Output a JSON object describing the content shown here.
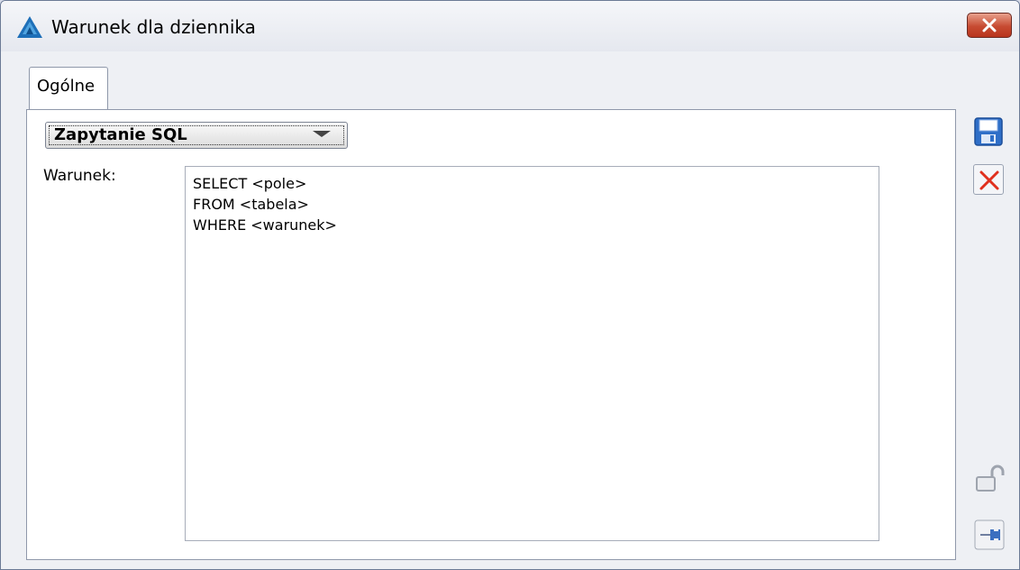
{
  "window": {
    "title": "Warunek dla dziennika",
    "accent": "#1a7bc4",
    "close_color": "#c74b32"
  },
  "tabs": [
    {
      "label": "Ogólne",
      "active": true
    }
  ],
  "form": {
    "mode_select": {
      "selected": "Zapytanie SQL"
    },
    "condition_label": "Warunek:",
    "condition_value": "SELECT <pole>\nFROM <tabela>\nWHERE <warunek>"
  },
  "toolbar": {
    "icons": [
      "save-icon",
      "cancel-icon",
      "lock-icon",
      "pin-icon"
    ]
  }
}
